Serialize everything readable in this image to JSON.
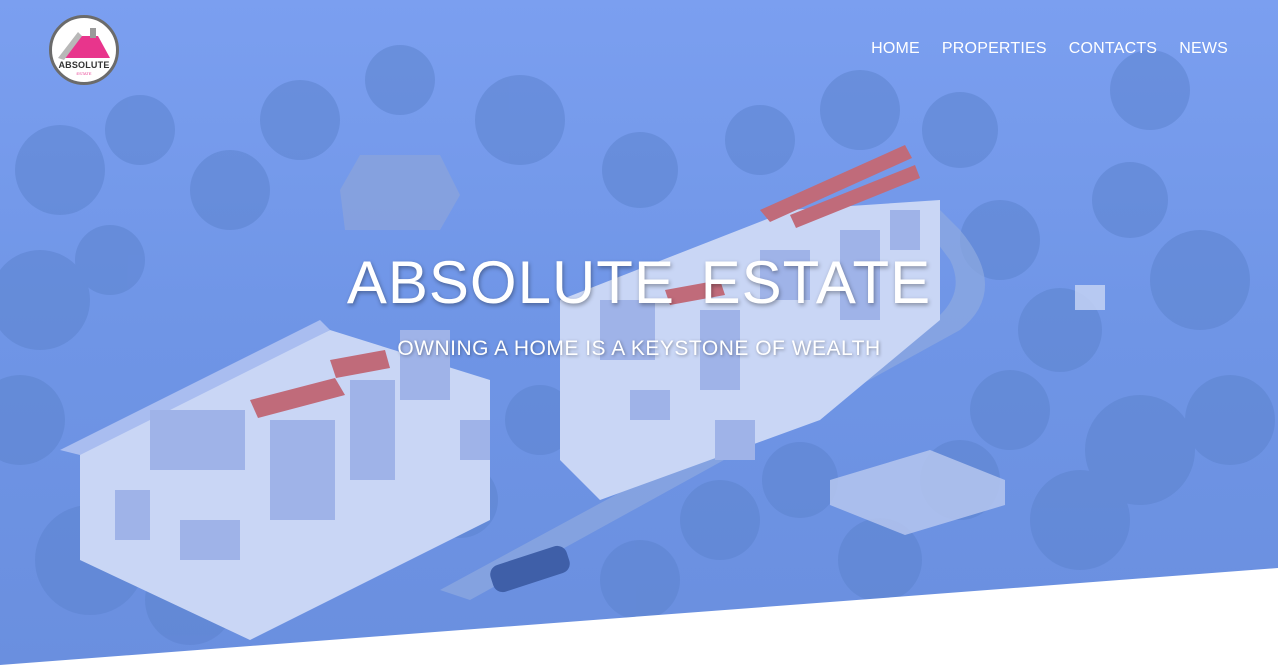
{
  "brand": {
    "logo_text": "ABSOLUTE",
    "logo_subtext": "ESTATE",
    "logo_icon": "house-roof-icon"
  },
  "nav": {
    "items": [
      {
        "label": "HOME"
      },
      {
        "label": "PROPERTIES"
      },
      {
        "label": "CONTACTS"
      },
      {
        "label": "NEWS"
      }
    ]
  },
  "hero": {
    "title": "ABSOLUTE ESTATE",
    "subtitle": "OWNING A HOME IS A KEYSTONE OF WEALTH"
  },
  "colors": {
    "overlay": "#6f94e8",
    "roof_accent": "#e8358c",
    "text": "#ffffff"
  }
}
